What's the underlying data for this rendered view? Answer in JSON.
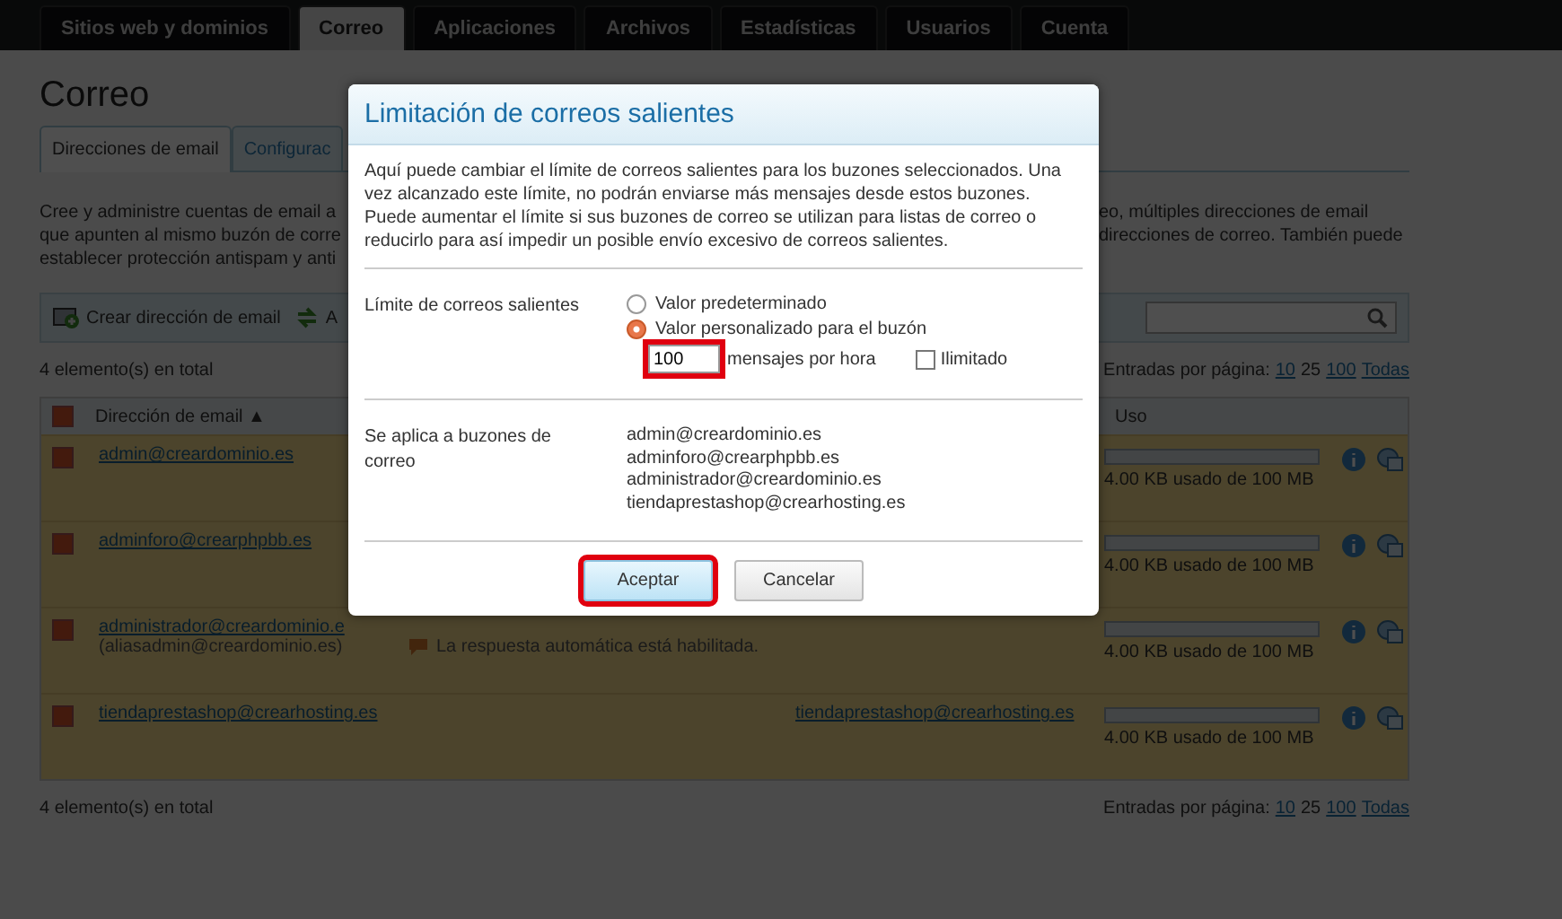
{
  "nav_tabs": [
    {
      "label": "Sitios web y dominios",
      "selected": false
    },
    {
      "label": "Correo",
      "selected": true
    },
    {
      "label": "Aplicaciones",
      "selected": false
    },
    {
      "label": "Archivos",
      "selected": false
    },
    {
      "label": "Estadísticas",
      "selected": false
    },
    {
      "label": "Usuarios",
      "selected": false
    },
    {
      "label": "Cuenta",
      "selected": false
    }
  ],
  "page_title": "Correo",
  "page_tabs": [
    {
      "label": "Direcciones de email",
      "selected": true
    },
    {
      "label": "Configurac",
      "selected": false
    }
  ],
  "description": [
    {
      "left": "Cree y administre cuentas de email a",
      "right": "eo, múltiples direcciones de email"
    },
    {
      "left": "que apunten al mismo buzón de corre",
      "right": "direcciones de correo. También puede"
    },
    {
      "left": "establecer protección antispam y anti"
    }
  ],
  "toolbar": [
    {
      "label": "Crear dirección de email"
    },
    {
      "label": "A"
    }
  ],
  "total_top": "4 elemento(s) en total",
  "pager_top": {
    "label": "Entradas por página:",
    "options": [
      {
        "label": "10",
        "selected": false
      },
      {
        "label": "25",
        "selected": true
      },
      {
        "label": "100",
        "selected": false
      },
      {
        "label": "Todas",
        "selected": false
      }
    ]
  },
  "table": {
    "header_checked": true,
    "columns": [
      {
        "label": "Dirección de email",
        "sort": "▲"
      },
      {
        "label": "Uso"
      }
    ],
    "rows": [
      {
        "checked": true,
        "email": "admin@creardominio.es",
        "usage": "4.00 KB usado de 100 MB",
        "level": 0
      },
      {
        "checked": true,
        "email": "adminforo@crearphpbb.es",
        "usage": "4.00 KB usado de 100 MB",
        "level": 0
      },
      {
        "checked": true,
        "email": "administrador@creardominio.e",
        "alias": "(aliasadmin@creardominio.es)",
        "note": "La respuesta automática está habilitada.",
        "usage": "4.00 KB usado de 100 MB",
        "level": 0
      },
      {
        "checked": true,
        "email": "tiendaprestashop@crearhosting.es",
        "forward": "tiendaprestashop@crearhosting.es",
        "usage": "4.00 KB usado de 100 MB",
        "level": 0
      }
    ]
  },
  "total_bottom": "4 elemento(s) en total",
  "pager_bottom": {
    "label": "Entradas por página:",
    "options": [
      {
        "label": "10",
        "selected": false
      },
      {
        "label": "25",
        "selected": true
      },
      {
        "label": "100",
        "selected": false
      },
      {
        "label": "Todas",
        "selected": false
      }
    ]
  },
  "dialog": {
    "title": "Limitación de correos salientes",
    "intro": "Aquí puede cambiar el límite de correos salientes para los buzones seleccionados. Una vez alcanzado este límite, no podrán enviarse más mensajes desde estos buzones. Puede aumentar el límite si sus buzones de correo se utilizan para listas de correo o reducirlo para así impedir un posible envío excesivo de correos salientes.",
    "limit_label": "Límite de correos salientes",
    "options": [
      {
        "label": "Valor predeterminado",
        "selected": false
      },
      {
        "label": "Valor personalizado para el buzón",
        "selected": true
      }
    ],
    "value": "100",
    "value_highlighted": true,
    "unit": "mensajes por hora",
    "unlimited": {
      "label": "Ilimitado",
      "checked": false
    },
    "applies_label": "Se aplica a buzones de correo",
    "mailboxes": [
      "admin@creardominio.es",
      "adminforo@crearphpbb.es",
      "administrador@creardominio.es",
      "tiendaprestashop@crearhosting.es"
    ],
    "buttons": [
      {
        "label": "Aceptar",
        "kind": "primary",
        "highlighted": true
      },
      {
        "label": "Cancelar",
        "kind": "secondary",
        "highlighted": false
      }
    ]
  }
}
